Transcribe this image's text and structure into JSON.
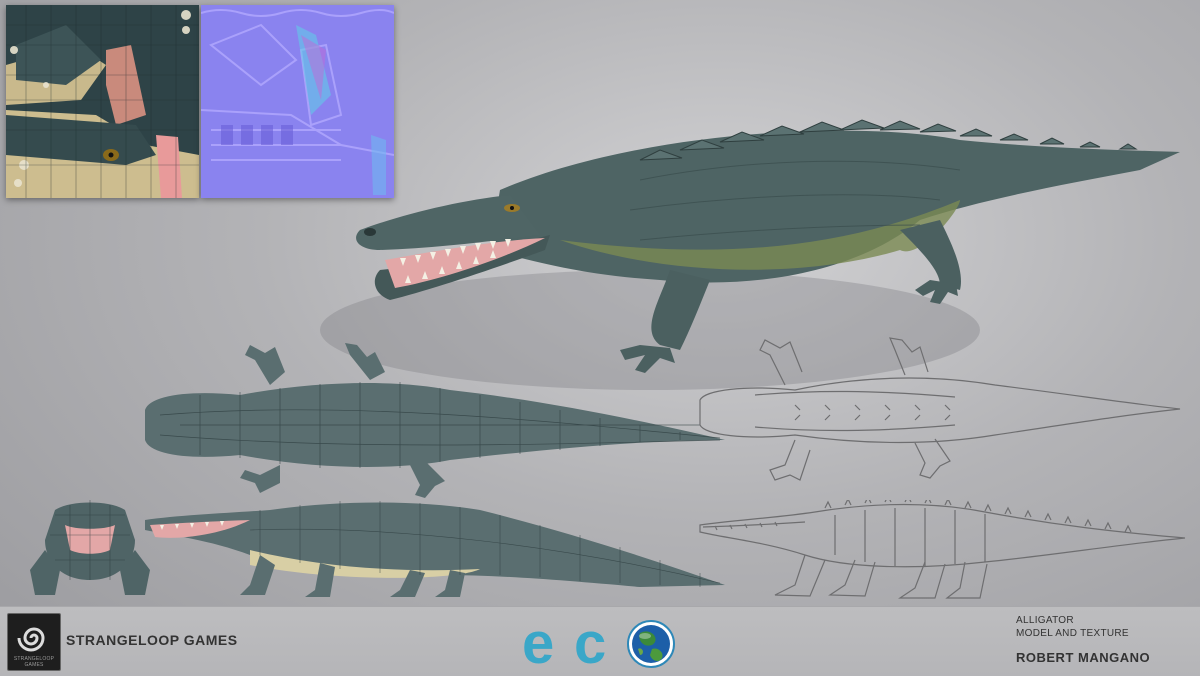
{
  "footer": {
    "studio_name": "STRANGELOOP GAMES",
    "studio_logo_tagline": "STRANGELOOP GAMES",
    "game_logo": {
      "letters": [
        "e",
        "c"
      ],
      "globe": "earth-globe-icon"
    },
    "credits": {
      "subject": "ALLIGATOR",
      "subtitle": "MODEL AND TEXTURE",
      "author": "ROBERT MANGANO"
    }
  },
  "colors": {
    "background": "#b3b3b6",
    "alligator_body": "#4e6464",
    "alligator_belly": "#7a8a52",
    "mouth": "#e3a7a7",
    "normal_map": "#8c84f0",
    "eco_letter": "#3aa7c8"
  }
}
